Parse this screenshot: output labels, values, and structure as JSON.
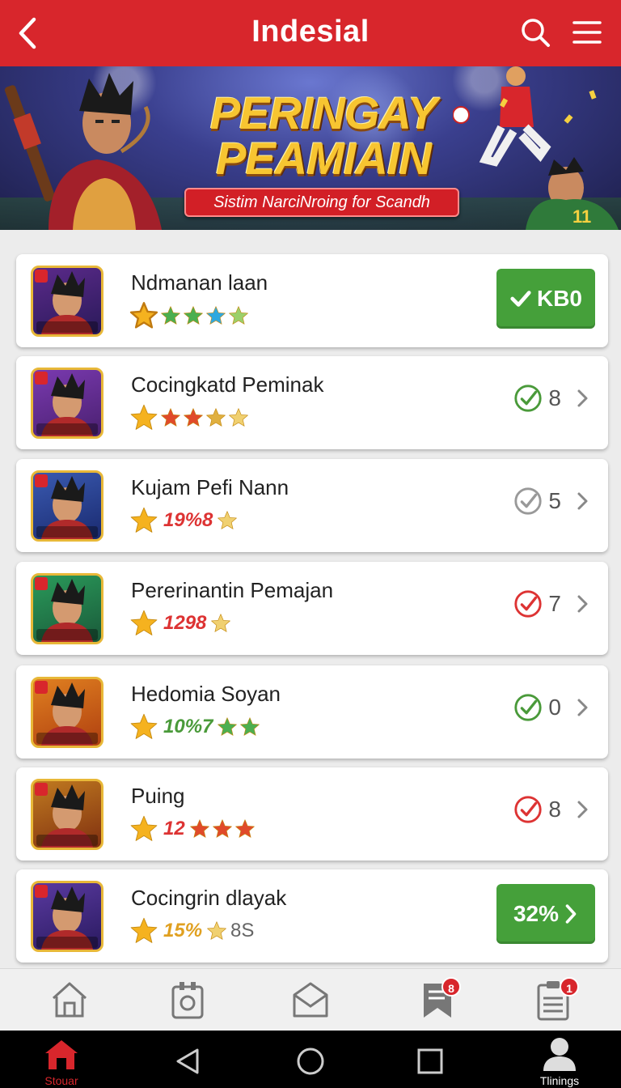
{
  "header": {
    "title": "Indesial",
    "back_icon": "back-arrow-icon",
    "search_icon": "search-icon",
    "menu_icon": "hamburger-menu-icon"
  },
  "banner": {
    "headline_line1": "PERINGAY",
    "headline_line2": "PEAMIAIN",
    "subtitle": "Sistim NarciNroing for Scandh"
  },
  "colors": {
    "primary_red": "#d8262c",
    "action_green": "#45a03a",
    "star_gold": "#f5b21f"
  },
  "items": [
    {
      "name": "Ndmanan laan",
      "rating_text": "",
      "action_label": "KB0"
    },
    {
      "name": "Cocingkatd Peminak",
      "rating_text": "",
      "count": "8"
    },
    {
      "name": "Kujam Pefi Nann",
      "rating_text": "19%8",
      "count": "5"
    },
    {
      "name": "Pererinantin Pemajan",
      "rating_text": "1298",
      "count": "7"
    },
    {
      "name": "Hedomia Soyan",
      "rating_text": "10%7",
      "count": "0"
    },
    {
      "name": "Puing",
      "rating_text": "12",
      "count": "8"
    },
    {
      "name": "Cocingrin dlayak",
      "rating_text": "15%",
      "rating_suffix": "8S",
      "action_label": "32%"
    }
  ],
  "bottom_nav": {
    "badges": {
      "bookmarks": "8",
      "clipboard": "1"
    }
  },
  "system_bar": {
    "home_label": "Stouar",
    "profile_label": "Tlinings"
  }
}
